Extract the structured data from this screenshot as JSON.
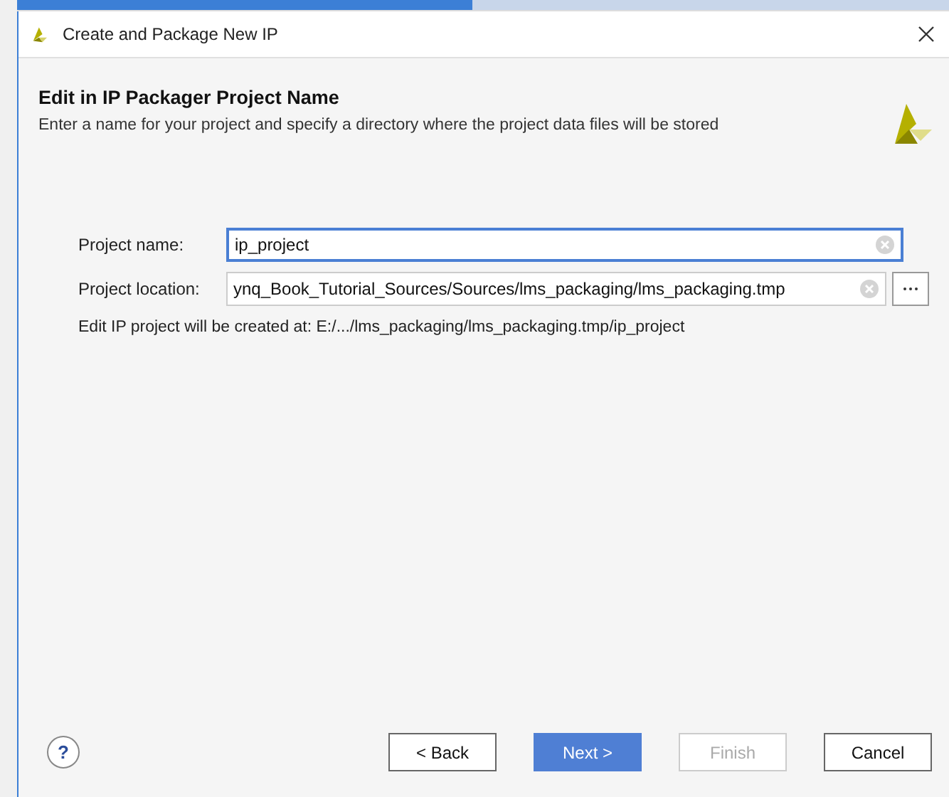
{
  "window": {
    "title": "Create and Package New IP"
  },
  "header": {
    "title": "Edit in IP Packager Project Name",
    "subtitle": "Enter a name for your project and specify a directory where the project data files will be stored"
  },
  "fields": [
    {
      "label": "Project name:",
      "value": "ip_project",
      "focused": true,
      "browse": false
    },
    {
      "label": "Project location:",
      "value": "ynq_Book_Tutorial_Sources/Sources/lms_packaging/lms_packaging.tmp",
      "focused": false,
      "browse": true
    }
  ],
  "info": "Edit IP project will be created at: E:/.../lms_packaging/lms_packaging.tmp/ip_project",
  "help": "?",
  "buttons": [
    {
      "label": "< Back",
      "default": false,
      "disabled": false
    },
    {
      "label": "Next >",
      "default": true,
      "disabled": false
    },
    {
      "label": "Finish",
      "default": false,
      "disabled": true
    },
    {
      "label": "Cancel",
      "default": false,
      "disabled": false
    }
  ]
}
